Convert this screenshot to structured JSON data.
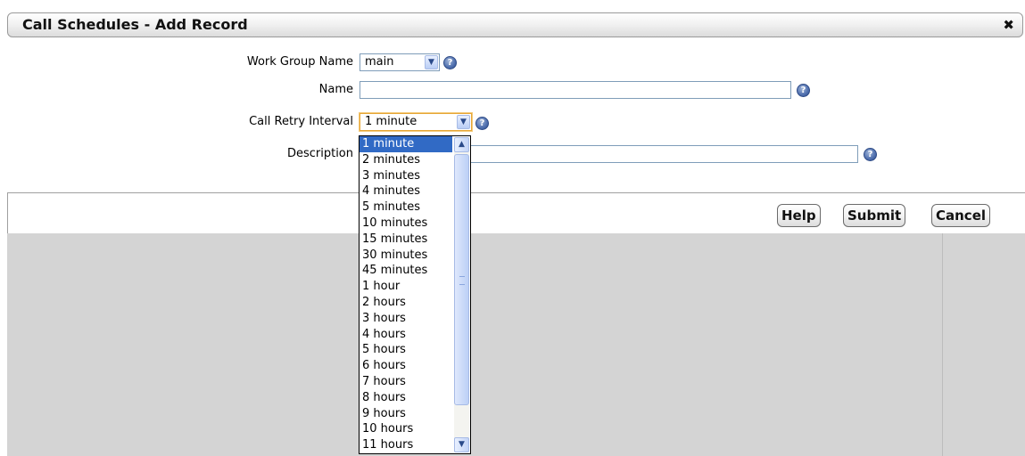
{
  "dialog": {
    "title": "Call Schedules - Add Record",
    "close_glyph": "✖"
  },
  "form": {
    "work_group": {
      "label": "Work Group Name",
      "value": "main"
    },
    "name": {
      "label": "Name",
      "value": ""
    },
    "call_retry_interval": {
      "label": "Call Retry Interval",
      "value": "1 minute"
    },
    "description": {
      "label": "Description",
      "value": ""
    }
  },
  "help_icon_glyph": "?",
  "dropdown": {
    "options": [
      "1 minute",
      "2 minutes",
      "3 minutes",
      "4 minutes",
      "5 minutes",
      "10 minutes",
      "15 minutes",
      "30 minutes",
      "45 minutes",
      "1 hour",
      "2 hours",
      "3 hours",
      "4 hours",
      "5 hours",
      "6 hours",
      "7 hours",
      "8 hours",
      "9 hours",
      "10 hours",
      "11 hours"
    ],
    "selected": "1 minute"
  },
  "buttons": {
    "help": "Help",
    "submit": "Submit",
    "cancel": "Cancel"
  },
  "icons": {
    "close": "close-icon",
    "help": "help-icon",
    "dropdown_arrow": "chevron-down-icon"
  }
}
